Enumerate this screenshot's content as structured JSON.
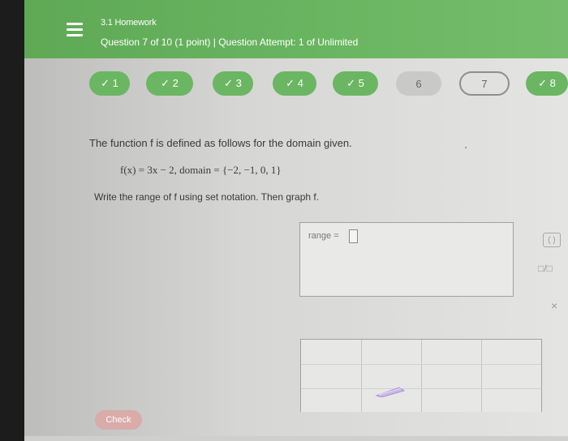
{
  "header": {
    "homework_title": "3.1 Homework",
    "question_info": "Question 7 of 10 (1 point)  |  Question Attempt: 1 of Unlimited"
  },
  "question_nav": [
    {
      "label": "✓ 1",
      "state": "done"
    },
    {
      "label": "✓ 2",
      "state": "done"
    },
    {
      "label": "✓ 3",
      "state": "done"
    },
    {
      "label": "✓ 4",
      "state": "done"
    },
    {
      "label": "✓ 5",
      "state": "done"
    },
    {
      "label": "6",
      "state": "unanswered"
    },
    {
      "label": "7",
      "state": "current"
    },
    {
      "label": "✓ 8",
      "state": "done"
    }
  ],
  "problem": {
    "statement": "The function f is defined as follows for the domain given.",
    "function_def": "f(x) = 3x − 2,    domain = {−2, −1, 0, 1}",
    "instruction": "Write the range of f using set notation. Then graph f."
  },
  "answer": {
    "range_label": "range =",
    "range_value": ""
  },
  "tools": {
    "paren": "( )",
    "fraction": "□/□",
    "clear": "×"
  },
  "check_label": "Check",
  "colors": {
    "header": "#6bb662",
    "nav_done": "#6bb662",
    "nav_plain": "#c9c9c7",
    "check": "#d9aba9"
  }
}
